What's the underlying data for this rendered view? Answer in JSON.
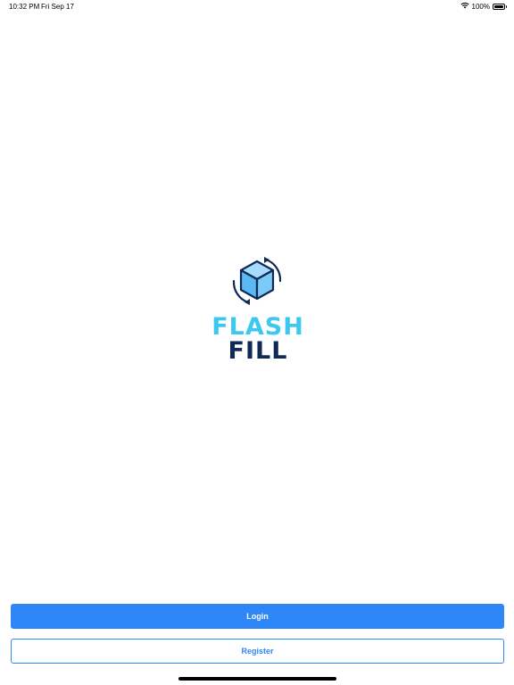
{
  "status_bar": {
    "time": "10:32 PM",
    "date": "Fri Sep 17",
    "battery": "100%",
    "wifi_icon": "wifi-icon",
    "battery_icon": "battery-icon"
  },
  "logo": {
    "line1": "FLASH",
    "line2": "FILL",
    "icon": "cube-refresh-icon",
    "colors": {
      "accent": "#3cc8f0",
      "dark": "#0f2a55"
    }
  },
  "actions": {
    "login_label": "Login",
    "register_label": "Register"
  },
  "colors": {
    "primary": "#2e86f7"
  }
}
